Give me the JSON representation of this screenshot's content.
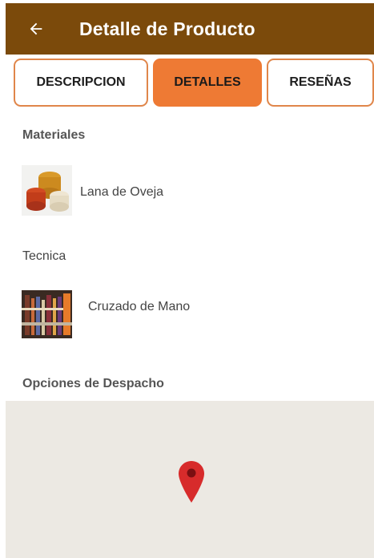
{
  "appbar": {
    "title": "Detalle de Producto",
    "back_icon": "arrow-left-icon",
    "background": "#7b4a0b"
  },
  "tabs": [
    {
      "label": "DESCRIPCION",
      "active": false
    },
    {
      "label": "DETALLES",
      "active": true
    },
    {
      "label": "RESEÑAS",
      "active": false
    }
  ],
  "accent_color": "#ee7a34",
  "details": {
    "materials_heading": "Materiales",
    "material": {
      "name": "Lana de Oveja",
      "image": "yarn-balls-thumbnail"
    },
    "technique_heading": "Tecnica",
    "technique": {
      "name": "Cruzado de Mano",
      "image": "loom-weaving-thumbnail"
    },
    "shipping_heading": "Opciones de Despacho"
  },
  "map": {
    "marker_icon": "map-pin-icon"
  }
}
